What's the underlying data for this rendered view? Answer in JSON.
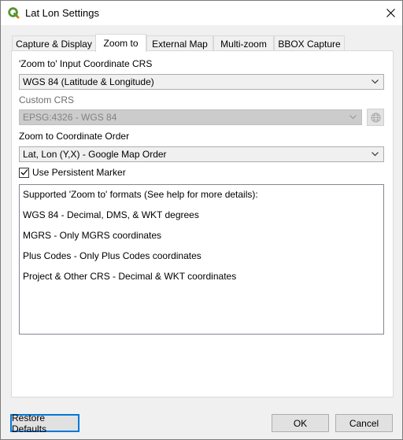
{
  "window": {
    "title": "Lat Lon Settings"
  },
  "tabs": [
    {
      "label": "Capture & Display",
      "active": false
    },
    {
      "label": "Zoom to",
      "active": true
    },
    {
      "label": "External Map",
      "active": false
    },
    {
      "label": "Multi-zoom",
      "active": false
    },
    {
      "label": "BBOX Capture",
      "active": false
    }
  ],
  "zoom_to": {
    "input_crs_label": "'Zoom to' Input Coordinate CRS",
    "input_crs_value": "WGS 84 (Latitude & Longitude)",
    "custom_crs_label": "Custom CRS",
    "custom_crs_value": "EPSG:4326 - WGS 84",
    "order_label": "Zoom to Coordinate Order",
    "order_value": "Lat, Lon (Y,X) - Google Map Order",
    "persistent_marker_label": "Use Persistent Marker",
    "persistent_marker_checked": true,
    "formats_info": [
      "Supported 'Zoom to' formats (See help for more details):",
      "WGS 84 - Decimal, DMS, & WKT degrees",
      "MGRS - Only MGRS coordinates",
      "Plus Codes - Only Plus Codes coordinates",
      "Project & Other CRS - Decimal & WKT coordinates"
    ]
  },
  "buttons": {
    "restore_defaults": "Restore Defaults",
    "ok": "OK",
    "cancel": "Cancel"
  },
  "colors": {
    "accent": "#0078d7",
    "qgis_green": "#589632",
    "qgis_yellow": "#ee7913"
  },
  "icons": {
    "app": "qgis-logo-icon",
    "close": "close-icon",
    "dropdown": "chevron-down-icon",
    "crs_select": "globe-icon",
    "checkbox": "checkmark-icon"
  }
}
